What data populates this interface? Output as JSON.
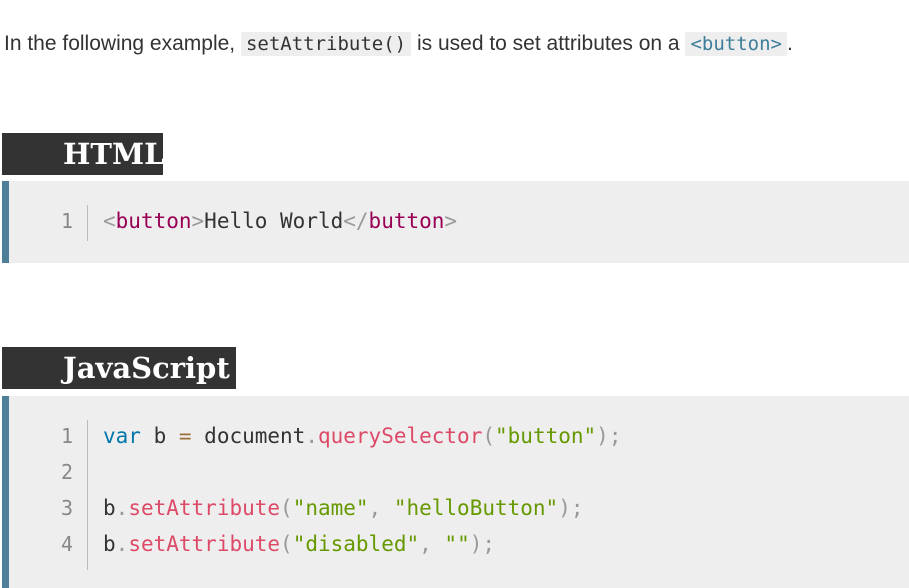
{
  "intro": {
    "before": "In the following example, ",
    "method": "setAttribute()",
    "middle": " is used to set attributes on a ",
    "element": "<button>",
    "after": "."
  },
  "sections": {
    "html": {
      "heading": "HTML",
      "lines": [
        {
          "number": "1",
          "tokens": [
            {
              "type": "punct",
              "text": "<"
            },
            {
              "type": "tag",
              "text": "button"
            },
            {
              "type": "punct",
              "text": ">"
            },
            {
              "type": "plain",
              "text": "Hello World"
            },
            {
              "type": "punct",
              "text": "</"
            },
            {
              "type": "tag",
              "text": "button"
            },
            {
              "type": "punct",
              "text": ">"
            }
          ]
        }
      ]
    },
    "javascript": {
      "heading": "JavaScript",
      "lines": [
        {
          "number": "1",
          "tokens": [
            {
              "type": "keyword",
              "text": "var"
            },
            {
              "type": "plain",
              "text": " b "
            },
            {
              "type": "op",
              "text": "="
            },
            {
              "type": "plain",
              "text": " document"
            },
            {
              "type": "punct",
              "text": "."
            },
            {
              "type": "func",
              "text": "querySelector"
            },
            {
              "type": "punct",
              "text": "("
            },
            {
              "type": "string",
              "text": "\"button\""
            },
            {
              "type": "punct",
              "text": ");"
            }
          ]
        },
        {
          "number": "2",
          "tokens": []
        },
        {
          "number": "3",
          "tokens": [
            {
              "type": "plain",
              "text": "b"
            },
            {
              "type": "punct",
              "text": "."
            },
            {
              "type": "func",
              "text": "setAttribute"
            },
            {
              "type": "punct",
              "text": "("
            },
            {
              "type": "string",
              "text": "\"name\""
            },
            {
              "type": "punct",
              "text": ", "
            },
            {
              "type": "string",
              "text": "\"helloButton\""
            },
            {
              "type": "punct",
              "text": ");"
            }
          ]
        },
        {
          "number": "4",
          "tokens": [
            {
              "type": "plain",
              "text": "b"
            },
            {
              "type": "punct",
              "text": "."
            },
            {
              "type": "func",
              "text": "setAttribute"
            },
            {
              "type": "punct",
              "text": "("
            },
            {
              "type": "string",
              "text": "\"disabled\""
            },
            {
              "type": "punct",
              "text": ", "
            },
            {
              "type": "string",
              "text": "\"\""
            },
            {
              "type": "punct",
              "text": ");"
            }
          ]
        }
      ]
    }
  }
}
